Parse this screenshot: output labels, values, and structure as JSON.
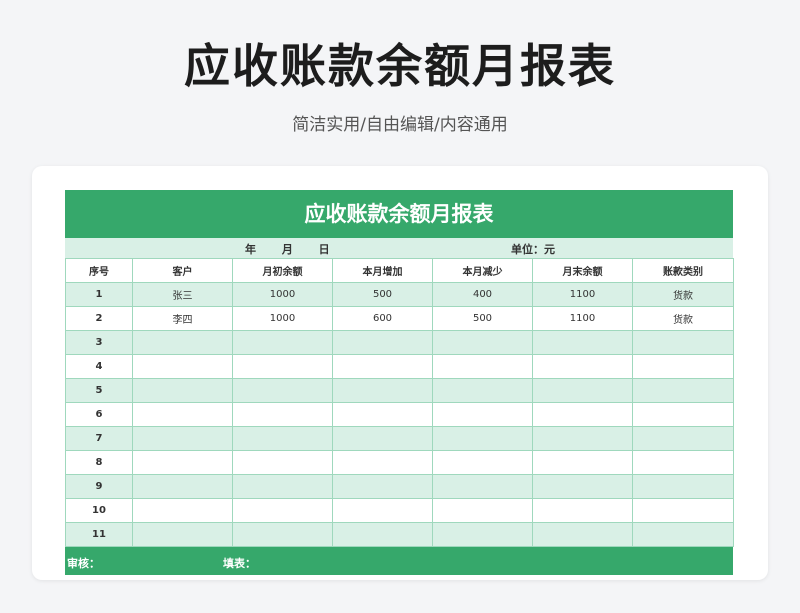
{
  "page": {
    "title": "应收账款余额月报表",
    "subtitle": "简洁实用/自由编辑/内容通用"
  },
  "sheet": {
    "title": "应收账款余额月报表",
    "date_label": "年 月 日",
    "unit_label": "单位：元",
    "headers": [
      "序号",
      "客户",
      "月初余额",
      "本月增加",
      "本月减少",
      "月末余额",
      "账款类别"
    ],
    "rows": [
      [
        "1",
        "张三",
        "1000",
        "500",
        "400",
        "1100",
        "货款"
      ],
      [
        "2",
        "李四",
        "1000",
        "600",
        "500",
        "1100",
        "货款"
      ],
      [
        "3",
        "",
        "",
        "",
        "",
        "",
        ""
      ],
      [
        "4",
        "",
        "",
        "",
        "",
        "",
        ""
      ],
      [
        "5",
        "",
        "",
        "",
        "",
        "",
        ""
      ],
      [
        "6",
        "",
        "",
        "",
        "",
        "",
        ""
      ],
      [
        "7",
        "",
        "",
        "",
        "",
        "",
        ""
      ],
      [
        "8",
        "",
        "",
        "",
        "",
        "",
        ""
      ],
      [
        "9",
        "",
        "",
        "",
        "",
        "",
        ""
      ],
      [
        "10",
        "",
        "",
        "",
        "",
        "",
        ""
      ],
      [
        "11",
        "",
        "",
        "",
        "",
        "",
        ""
      ]
    ],
    "footer": {
      "reviewer_label": "审核：",
      "filler_label": "填表："
    }
  },
  "colors": {
    "accent": "#36a86b",
    "stripe": "#d9f0e6",
    "border": "#9fd8bd"
  }
}
